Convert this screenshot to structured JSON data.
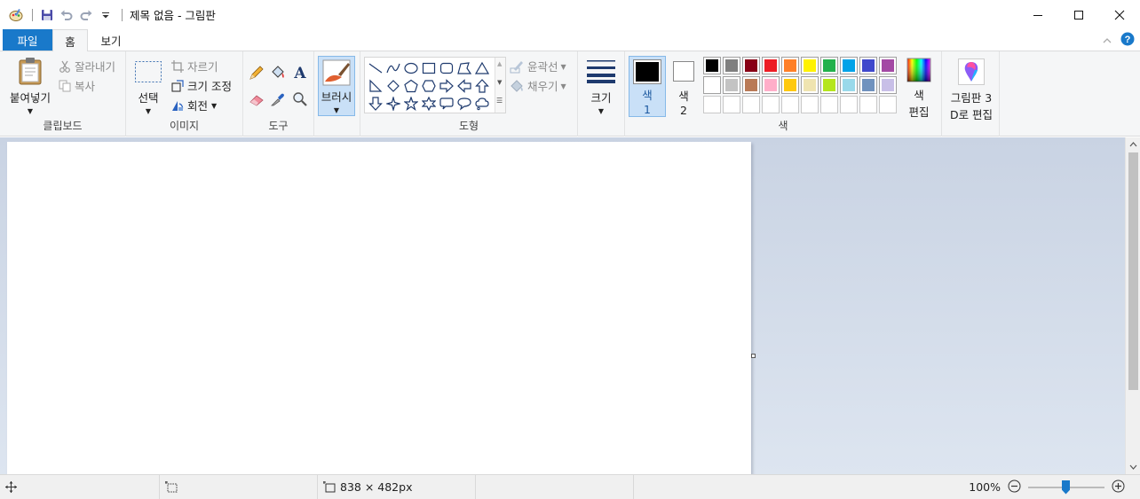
{
  "window": {
    "title": "제목 없음 - 그림판",
    "controls": [
      "minimize-icon",
      "maximize-icon",
      "close-icon"
    ]
  },
  "quick_access": {
    "icons": [
      "paint-app-icon",
      "save-icon",
      "undo-icon",
      "redo-icon",
      "customize-dropdown-icon"
    ]
  },
  "tabs": [
    {
      "label": "파일",
      "active": false
    },
    {
      "label": "홈",
      "active": true
    },
    {
      "label": "보기",
      "active": false
    }
  ],
  "ribbon": {
    "clipboard": {
      "group_label": "클립보드",
      "paste": "붙여넣기",
      "cut": "잘라내기",
      "copy": "복사"
    },
    "image": {
      "group_label": "이미지",
      "select": "선택",
      "crop": "자르기",
      "resize": "크기 조정",
      "rotate": "회전"
    },
    "tools": {
      "group_label": "도구",
      "icons": [
        "pencil-icon",
        "fill-icon",
        "text-icon",
        "eraser-icon",
        "color-picker-icon",
        "magnifier-icon"
      ]
    },
    "brushes": {
      "label": "브러시"
    },
    "shapes": {
      "group_label": "도형",
      "outline": "윤곽선",
      "fill": "채우기"
    },
    "size": {
      "label": "크기"
    },
    "colors": {
      "group_label": "색",
      "color1_label": "색",
      "color1_num": "1",
      "color2_label": "색",
      "color2_num": "2",
      "edit_colors_line1": "색",
      "edit_colors_line2": "편집",
      "color1": "#000000",
      "color2": "#ffffff",
      "palette_row1": [
        "#000000",
        "#7f7f7f",
        "#880015",
        "#ed1c24",
        "#ff7f27",
        "#fff200",
        "#22b14c",
        "#00a2e8",
        "#3f48cc",
        "#a349a4"
      ],
      "palette_row2": [
        "#ffffff",
        "#c3c3c3",
        "#b97a57",
        "#ffaec9",
        "#ffc90e",
        "#efe4b0",
        "#b5e61d",
        "#99d9ea",
        "#7092be",
        "#c8bfe7"
      ]
    },
    "paint3d": {
      "line1": "그림판 3",
      "line2": "D로 편집"
    }
  },
  "status": {
    "canvas_size": "838 × 482px",
    "zoom_level": "100%"
  }
}
